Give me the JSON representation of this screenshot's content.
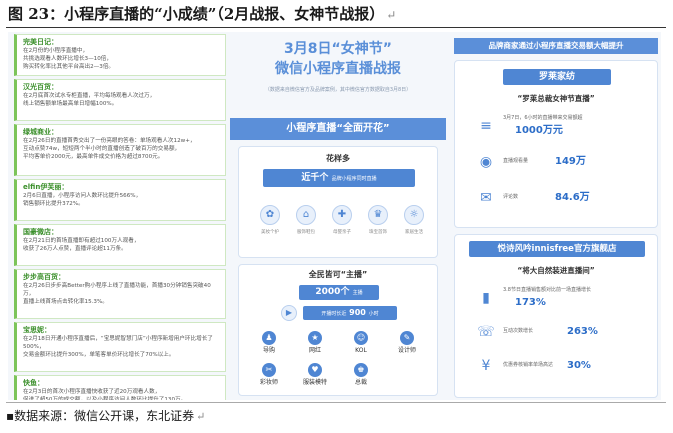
{
  "figure": {
    "title": "图 23：小程序直播的“小成绩”（2月战报、女神节战报）",
    "return_mark": "↵",
    "source": "▪数据来源：微信公开课，东北证券"
  },
  "left_cards": [
    {
      "title": "完美日记：",
      "lines": [
        "在2月份的小程序直播中，",
        "共挑选观看人数环比增长3—10倍，",
        "购买转化率比其他平台高出2—3倍。"
      ]
    },
    {
      "title": "汉光百货：",
      "lines": [
        "在2月底首次试水专柜直播，平均每场观看人次过万，",
        "线上销售额单场最高单日增幅100%。"
      ]
    },
    {
      "title": "绿城商业：",
      "lines": [
        "在2月26日的直播首秀交出了一份亮眼的答卷：单场观看人次12w+，",
        "互动点赞74w，短短两个半小时的直播创造了破百万的交易额，",
        "平均客单价2000元，最高单件成交价格为超过8700元。"
      ]
    },
    {
      "title": "elfin伊芙丽：",
      "lines": [
        "2月6日直播，小程序访问人数环比提升566%，",
        "销售额环比提升372%。"
      ]
    },
    {
      "title": "国豪微店：",
      "lines": [
        "在2月21日的首场直播即有超过100万人观看，",
        "收获了26万人点赞，直播评论超11万条。"
      ]
    },
    {
      "title": "步步高百货：",
      "lines": [
        "在2月26日步步高Better购小程序上线了直播功能，首播30分钟销售突破40万，",
        "直播上线首场点击转化率15.3%。"
      ]
    },
    {
      "title": "宝思妮：",
      "lines": [
        "在2月18日开通小程序直播后，“宝思妮智慧门店”小程序新增用户环比增长了500%，",
        "交易金额环比提升300%，单笔客单价环比增长了70%以上。"
      ]
    },
    {
      "title": "快鱼：",
      "lines": [
        "在2月3日的首次小程序直播快收获了近20万观看人数，",
        "促进了超50万的成交额，以及小程序访问人数环比提升了130万。"
      ]
    }
  ],
  "middle": {
    "hero_line1": "3月8日“女神节”",
    "hero_line2": "微信小程序直播战报",
    "hero_note": "（数据来自微信官方及品牌案例，其中微信官方数据取自3月8日）",
    "band": "小程序直播“全面开花”",
    "sec1_title": "花样多",
    "sec1_pill_big": "近千个",
    "sec1_pill_small": "品牌小程序同时直播",
    "sec1_icons": [
      {
        "glyph": "✿",
        "label": "美妆个护"
      },
      {
        "glyph": "⌂",
        "label": "服饰鞋包"
      },
      {
        "glyph": "✚",
        "label": "母婴亲子"
      },
      {
        "glyph": "♛",
        "label": "珠宝首饰"
      },
      {
        "glyph": "☼",
        "label": "家居生活"
      }
    ],
    "sec2_title": "全民皆可“主播”",
    "sec2_count": "2000个",
    "sec2_count_unit": "主播",
    "sec2_hours_label": "开播时长近",
    "sec2_hours": "900",
    "sec2_hours_unit": "小时",
    "roles": [
      {
        "glyph": "♟",
        "label": "导购"
      },
      {
        "glyph": "★",
        "label": "网红"
      },
      {
        "glyph": "☺",
        "label": "KOL"
      },
      {
        "glyph": "✎",
        "label": "设计师"
      },
      {
        "glyph": "✂",
        "label": "彩妆师"
      },
      {
        "glyph": "♥",
        "label": "服装模特"
      },
      {
        "glyph": "♚",
        "label": "总裁"
      }
    ]
  },
  "right": {
    "top_band": "品牌商家通过小程序直播交易额大幅提升",
    "brand1": "罗莱家纺",
    "brand1_quote": "“罗莱总裁女神节直播”",
    "brand1_stats": [
      {
        "icon": "database-icon",
        "glyph": "≡",
        "label": "3月7日，6小时的直播带来交易额超",
        "value": "1000万元"
      },
      {
        "icon": "eye-icon",
        "glyph": "◉",
        "label": "直播观看量",
        "value": "149万"
      },
      {
        "icon": "comment-icon",
        "glyph": "✉",
        "label": "评论数",
        "value": "84.6万"
      }
    ],
    "brand2": "悦诗风吟innisfree官方旗舰店",
    "brand2_quote": "“将大自然装进直播间”",
    "brand2_stats": [
      {
        "icon": "bar-chart-icon",
        "glyph": "▮",
        "label": "3.8节日直播销售额对比前一场直播增长",
        "value": "173%"
      },
      {
        "icon": "chat-icon",
        "glyph": "☏",
        "label": "互动次数增长",
        "value": "263%"
      },
      {
        "icon": "coupon-icon",
        "glyph": "¥",
        "label": "优惠券核销率单场高达",
        "value": "30%"
      }
    ]
  }
}
